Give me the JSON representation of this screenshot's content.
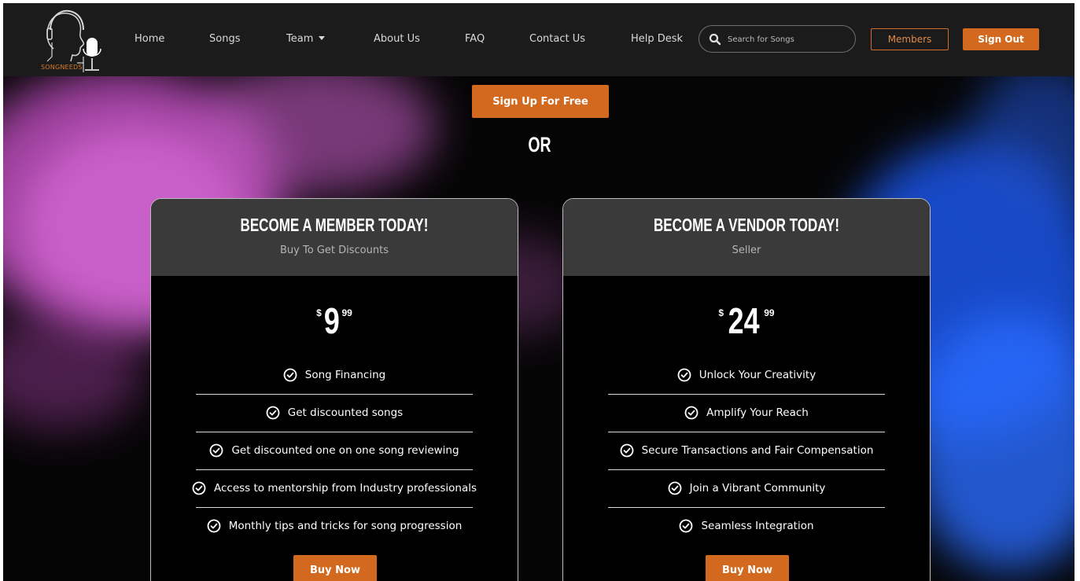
{
  "nav": {
    "logo_text": "SONGNEEDS",
    "links": [
      "Home",
      "Songs",
      "Team",
      "About Us",
      "FAQ",
      "Contact Us",
      "Help Desk"
    ],
    "search_placeholder": "Search for Songs",
    "members_label": "Members",
    "signout_label": "Sign Out"
  },
  "hero": {
    "signup_label": "Sign Up For Free",
    "or_text": "OR"
  },
  "cards": [
    {
      "title": "BECOME A MEMBER TODAY!",
      "subtitle": "Buy To Get Discounts",
      "currency": "$",
      "price": "9",
      "cents": "99",
      "features": [
        "Song Financing",
        "Get discounted songs",
        "Get discounted one on one song reviewing",
        "Access to mentorship from Industry professionals",
        "Monthly tips and tricks for song progression"
      ],
      "button_label": "Buy Now"
    },
    {
      "title": "BECOME A VENDOR TODAY!",
      "subtitle": "Seller",
      "currency": "$",
      "price": "24",
      "cents": "99",
      "features": [
        "Unlock Your Creativity",
        "Amplify Your Reach",
        "Secure Transactions and Fair Compensation",
        "Join a Vibrant Community",
        "Seamless Integration"
      ],
      "button_label": "Buy Now"
    }
  ],
  "colors": {
    "accent": "#d2691e",
    "nav_bg": "#1b1b1b",
    "card_head": "#3a3a3a",
    "pink_smoke": "#c050c0",
    "blue_smoke": "#1a5cf0"
  },
  "icons": {
    "logo": "headphones-microphone-logo",
    "search": "search-icon",
    "check": "check-circle-icon",
    "dropdown": "caret-down-icon"
  }
}
